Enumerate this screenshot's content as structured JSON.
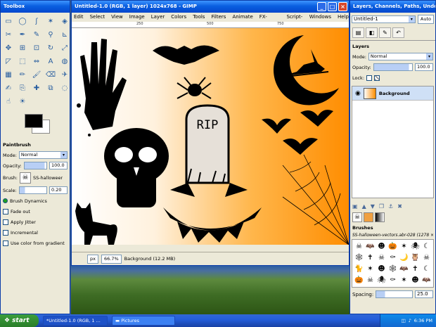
{
  "toolbox": {
    "title": "Toolbox",
    "tools": [
      "rect-select",
      "ellipse-select",
      "free-select",
      "fuzzy-select",
      "color-select",
      "scissors",
      "paths",
      "color-picker",
      "zoom",
      "measure",
      "move",
      "align",
      "crop",
      "rotate",
      "scale",
      "shear",
      "perspective",
      "flip",
      "text",
      "bucket-fill",
      "blend",
      "pencil",
      "paintbrush",
      "eraser",
      "airbrush",
      "ink",
      "clone",
      "heal",
      "perspective-clone",
      "blur",
      "smudge",
      "dodge"
    ],
    "options_title": "Paintbrush",
    "mode_label": "Mode:",
    "mode_value": "Normal",
    "opacity_label": "Opacity:",
    "opacity_value": "100.0",
    "brush_label": "Brush:",
    "brush_value": "SS-halloween-vect",
    "scale_label": "Scale:",
    "scale_value": "0.20",
    "brush_dynamics": "Brush Dynamics",
    "fade_out": "Fade out",
    "apply_jitter": "Apply Jitter",
    "incremental": "Incremental",
    "use_color_gradient": "Use color from gradient"
  },
  "image_window": {
    "title": "Untitled-1.0 (RGB, 1 layer) 1024x768 - GIMP",
    "menu": [
      "Edit",
      "Select",
      "View",
      "Image",
      "Layer",
      "Colors",
      "Tools",
      "Filters",
      "Animate",
      "FX-Foundry",
      "Script-Fu",
      "Windows",
      "Help"
    ],
    "ruler_marks": [
      "250",
      "500",
      "750"
    ],
    "canvas_text": "RIP",
    "unit": "px",
    "zoom": "66.7%",
    "status": "Background (12.2 MB)"
  },
  "dock": {
    "title": "Layers, Channels, Paths, Undo - ...",
    "image_select": "Untitled-1",
    "auto_button": "Auto",
    "layers_title": "Layers",
    "mode_label": "Mode:",
    "mode_value": "Normal",
    "opacity_label": "Opacity:",
    "opacity_value": "100.0",
    "lock_label": "Lock:",
    "layer_name": "Background",
    "brushes_title": "Brushes",
    "brush_name": "SS-halloween-vectors.abr-028 (1278 × 1712)",
    "spacing_label": "Spacing:",
    "spacing_value": "25.0"
  },
  "taskbar": {
    "start": "start",
    "tasks": [
      "*Untitled-1.0 (RGB, 1 ...",
      "Pictures"
    ],
    "time": "6:36 PM"
  },
  "colors": {
    "accent": "#0a5fe0",
    "canvas_orange": "#ff8d00",
    "selection": "#cfe0f6"
  }
}
